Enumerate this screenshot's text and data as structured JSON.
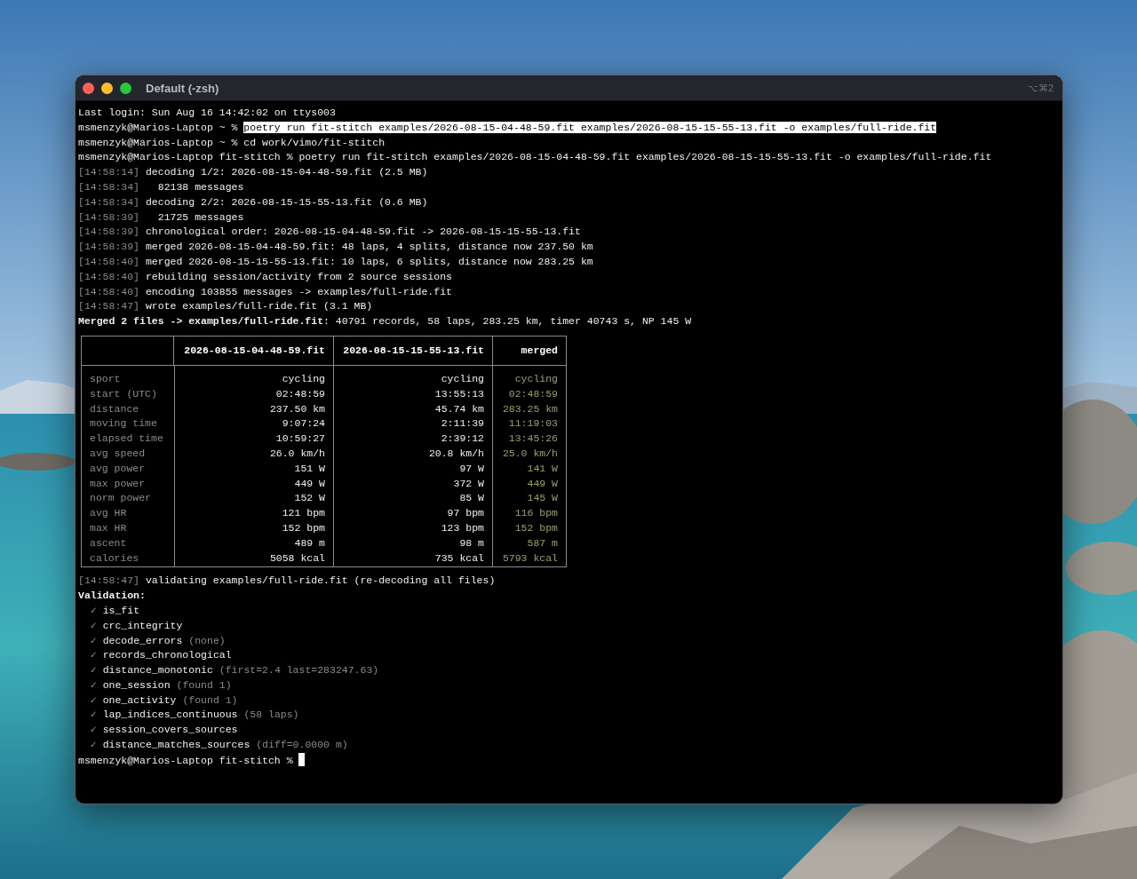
{
  "window": {
    "title": "Default (-zsh)",
    "shortcut": "⌥⌘2"
  },
  "output": [
    {
      "kind": "plain",
      "text": "Last login: Sun Aug 16 14:42:02 on ttys003"
    },
    {
      "kind": "prompt",
      "prompt": "msmenzyk@Marios-Laptop ~ %",
      "command": "poetry run fit-stitch examples/2026-08-15-04-48-59.fit examples/2026-08-15-15-55-13.fit -o examples/full-ride.fit",
      "selected": true
    },
    {
      "kind": "prompt",
      "prompt": "msmenzyk@Marios-Laptop ~ %",
      "command": "cd work/vimo/fit-stitch",
      "selected": false
    },
    {
      "kind": "prompt",
      "prompt": "msmenzyk@Marios-Laptop fit-stitch %",
      "command": "poetry run fit-stitch examples/2026-08-15-04-48-59.fit examples/2026-08-15-15-55-13.fit -o examples/full-ride.fit",
      "selected": false
    },
    {
      "kind": "log",
      "time": "[14:58:14]",
      "message": "decoding 1/2: 2026-08-15-04-48-59.fit (2.5 MB)"
    },
    {
      "kind": "log",
      "time": "[14:58:34]",
      "message": "  82138 messages"
    },
    {
      "kind": "log",
      "time": "[14:58:34]",
      "message": "decoding 2/2: 2026-08-15-15-55-13.fit (0.6 MB)"
    },
    {
      "kind": "log",
      "time": "[14:58:39]",
      "message": "  21725 messages"
    },
    {
      "kind": "log",
      "time": "[14:58:39]",
      "message": "chronological order: 2026-08-15-04-48-59.fit -> 2026-08-15-15-55-13.fit"
    },
    {
      "kind": "log",
      "time": "[14:58:39]",
      "message": "merged 2026-08-15-04-48-59.fit: 48 laps, 4 splits, distance now 237.50 km"
    },
    {
      "kind": "log",
      "time": "[14:58:40]",
      "message": "merged 2026-08-15-15-55-13.fit: 10 laps, 6 splits, distance now 283.25 km"
    },
    {
      "kind": "log",
      "time": "[14:58:40]",
      "message": "rebuilding session/activity from 2 source sessions"
    },
    {
      "kind": "log",
      "time": "[14:58:40]",
      "message": "encoding 103855 messages -> examples/full-ride.fit"
    },
    {
      "kind": "log",
      "time": "[14:58:47]",
      "message": "wrote examples/full-ride.fit (3.1 MB)"
    },
    {
      "kind": "summary",
      "text": "**Merged 2 files -> examples/full-ride.fit**: 40791 records, 58 laps, 283.25 km, timer 40743 s, NP 145 W"
    },
    {
      "kind": "table",
      "columns": [
        {
          "label": "2026-08-15-04-48-59.fit",
          "kind": "source"
        },
        {
          "label": "2026-08-15-15-55-13.fit",
          "kind": "source"
        },
        {
          "label": "merged",
          "kind": "merged"
        }
      ],
      "rows": [
        {
          "label": "sport",
          "values": [
            "cycling",
            "cycling",
            "cycling"
          ]
        },
        {
          "label": "start (UTC)",
          "values": [
            "02:48:59",
            "13:55:13",
            "02:48:59"
          ]
        },
        {
          "label": "distance",
          "values": [
            "237.50 km",
            "45.74 km",
            "283.25 km"
          ]
        },
        {
          "label": "moving time",
          "values": [
            "9:07:24",
            "2:11:39",
            "11:19:03"
          ]
        },
        {
          "label": "elapsed time",
          "values": [
            "10:59:27",
            "2:39:12",
            "13:45:26"
          ]
        },
        {
          "label": "avg speed",
          "values": [
            "26.0 km/h",
            "20.8 km/h",
            "25.0 km/h"
          ]
        },
        {
          "label": "avg power",
          "values": [
            "151 W",
            "97 W",
            "141 W"
          ]
        },
        {
          "label": "max power",
          "values": [
            "449 W",
            "372 W",
            "449 W"
          ]
        },
        {
          "label": "norm power",
          "values": [
            "152 W",
            "85 W",
            "145 W"
          ]
        },
        {
          "label": "avg HR",
          "values": [
            "121 bpm",
            "97 bpm",
            "116 bpm"
          ]
        },
        {
          "label": "max HR",
          "values": [
            "152 bpm",
            "123 bpm",
            "152 bpm"
          ]
        },
        {
          "label": "ascent",
          "values": [
            "489 m",
            "98 m",
            "587 m"
          ]
        },
        {
          "label": "calories",
          "values": [
            "5058 kcal",
            "735 kcal",
            "5793 kcal"
          ]
        }
      ]
    },
    {
      "kind": "log",
      "time": "[14:58:47]",
      "message": "validating examples/full-ride.fit (re-decoding all files)"
    },
    {
      "kind": "heading",
      "text": "Validation:"
    },
    {
      "kind": "check",
      "mark": "✓",
      "name": "is_fit"
    },
    {
      "kind": "check",
      "mark": "✓",
      "name": "crc_integrity"
    },
    {
      "kind": "check",
      "mark": "✓",
      "name": "decode_errors",
      "detail": "(none)"
    },
    {
      "kind": "check",
      "mark": "✓",
      "name": "records_chronological"
    },
    {
      "kind": "check",
      "mark": "✓",
      "name": "distance_monotonic",
      "detail": "(first=2.4 last=283247.63)"
    },
    {
      "kind": "check",
      "mark": "✓",
      "name": "one_session",
      "detail": "(found 1)"
    },
    {
      "kind": "check",
      "mark": "✓",
      "name": "one_activity",
      "detail": "(found 1)"
    },
    {
      "kind": "check",
      "mark": "✓",
      "name": "lap_indices_continuous",
      "detail": "(58 laps)"
    },
    {
      "kind": "check",
      "mark": "✓",
      "name": "session_covers_sources"
    },
    {
      "kind": "check",
      "mark": "✓",
      "name": "distance_matches_sources",
      "detail": "(diff=0.0000 m)"
    },
    {
      "kind": "prompt",
      "prompt": "msmenzyk@Marios-Laptop fit-stitch %",
      "cursor": true
    }
  ]
}
